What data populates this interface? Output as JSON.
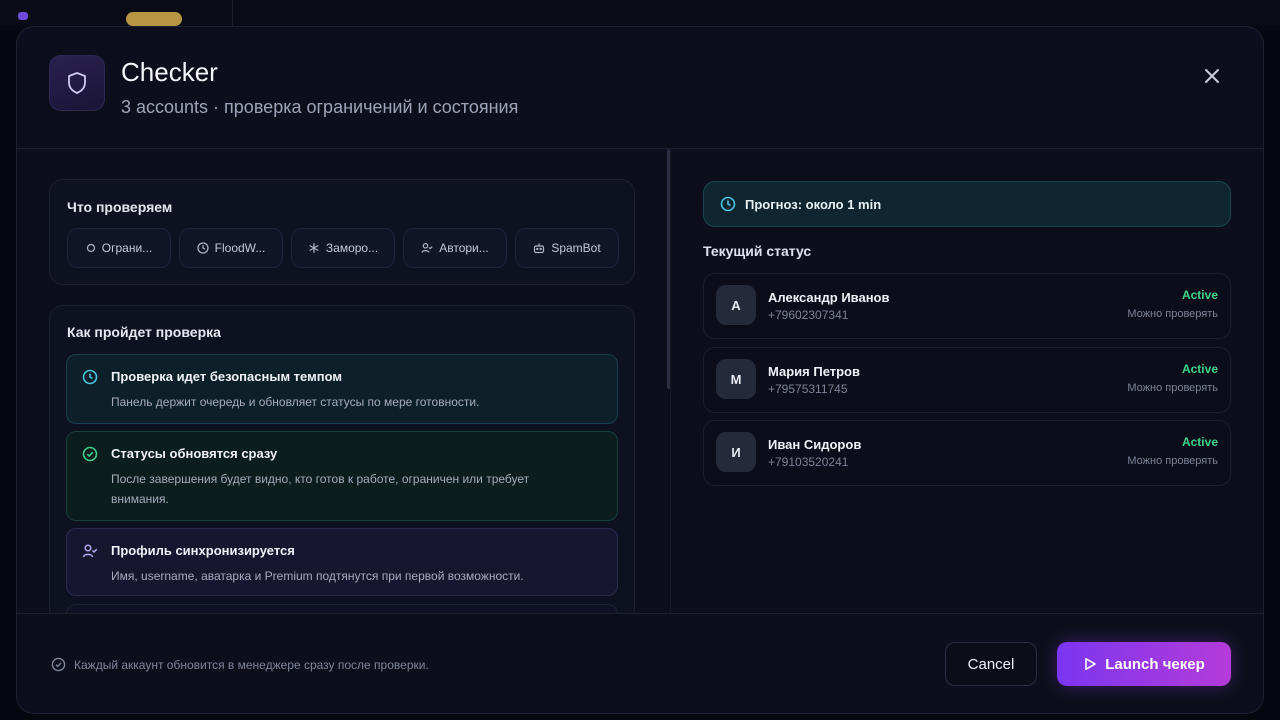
{
  "colors": {
    "accent_purple": "#7b36f0",
    "accent_magenta": "#b43bd9",
    "status_active": "#3ed48a",
    "forecast_teal": "#0f2530",
    "modal_bg": "#0c0f1b"
  },
  "header": {
    "icon": "shield-icon",
    "title": "Checker",
    "subtitle": "3 accounts · проверка ограничений и состояния",
    "close_icon": "close-icon"
  },
  "checks": {
    "title": "Что проверяем",
    "items": [
      {
        "label": "Ограни...",
        "icon": "circle-icon"
      },
      {
        "label": "FloodW...",
        "icon": "clock-icon"
      },
      {
        "label": "Заморо...",
        "icon": "snowflake-icon"
      },
      {
        "label": "Автори...",
        "icon": "user-check-icon"
      },
      {
        "label": "SpamBot",
        "icon": "bot-icon"
      }
    ]
  },
  "process": {
    "title": "Как пройдет проверка",
    "steps": [
      {
        "title": "Проверка идет безопасным темпом",
        "desc": "Панель держит очередь и обновляет статусы по мере готовности.",
        "icon": "clock-icon"
      },
      {
        "title": "Статусы обновятся сразу",
        "desc": "После завершения будет видно, кто готов к работе, ограничен или требует внимания.",
        "icon": "check-circle-icon"
      },
      {
        "title": "Профиль синхронизируется",
        "desc": "Имя, username, аватарка и Premium подтянутся при первой возможности.",
        "icon": "user-check-icon"
      }
    ]
  },
  "forecast": {
    "icon": "clock-icon",
    "text": "Прогноз: около 1 min"
  },
  "status": {
    "title": "Текущий статус",
    "accounts": [
      {
        "initial": "А",
        "name": "Александр Иванов",
        "phone": "+79602307341",
        "status": "Active",
        "hint": "Можно проверять"
      },
      {
        "initial": "М",
        "name": "Мария Петров",
        "phone": "+79575311745",
        "status": "Active",
        "hint": "Можно проверять"
      },
      {
        "initial": "И",
        "name": "Иван Сидоров",
        "phone": "+79103520241",
        "status": "Active",
        "hint": "Можно проверять"
      }
    ]
  },
  "footer": {
    "note": "Каждый аккаунт обновится в менеджере сразу после проверки.",
    "cancel_label": "Cancel",
    "launch_label": "Launch чекер"
  }
}
